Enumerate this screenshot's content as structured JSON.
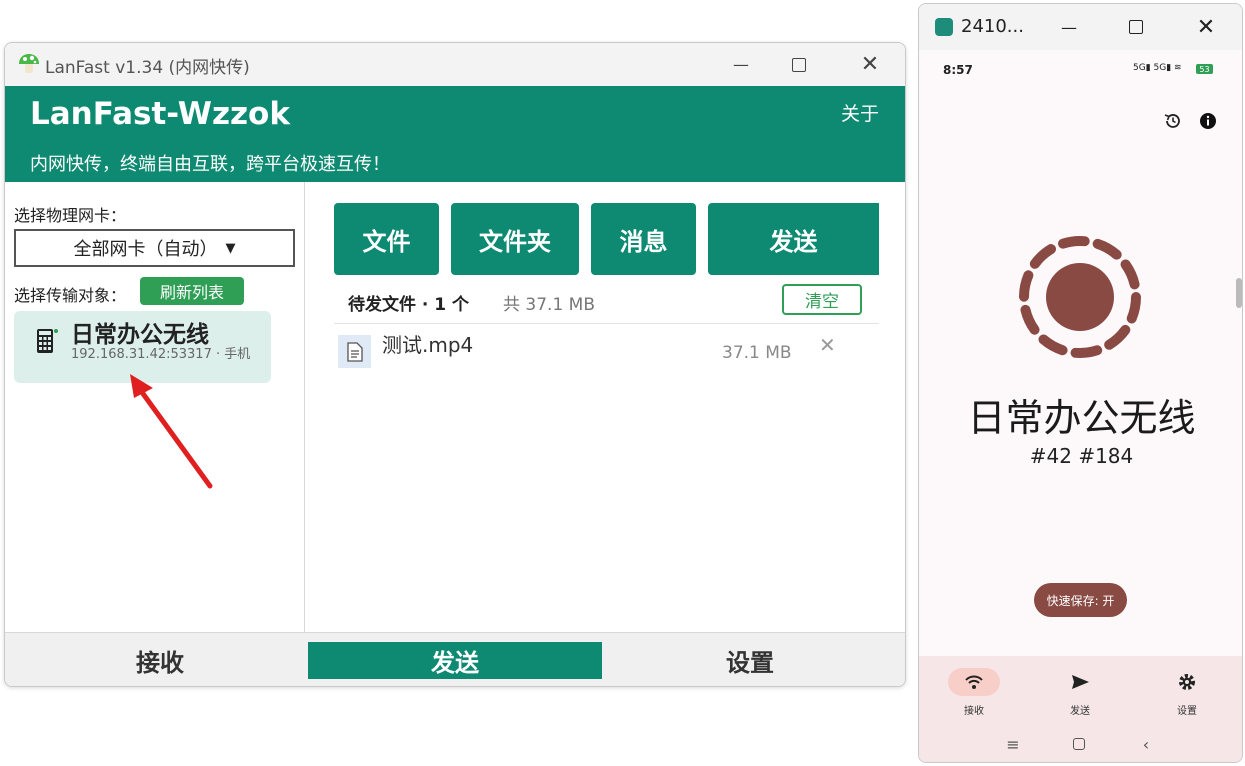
{
  "desktop": {
    "window_title": "LanFast v1.34 (内网快传)",
    "app_name": "LanFast-Wzzok",
    "about_label": "关于",
    "slogan": "内网快传，终端自由互联，跨平台极速互传！",
    "left": {
      "nic_label": "选择物理网卡：",
      "nic_value": "全部网卡（自动）",
      "target_label": "选择传输对象：",
      "refresh_label": "刷新列表",
      "device": {
        "name": "日常办公无线",
        "address": "192.168.31.42:53317 · 手机"
      }
    },
    "right": {
      "buttons": [
        "文件",
        "文件夹",
        "消息",
        "发送"
      ],
      "pending_label": "待发文件 · 1 个",
      "pending_size": "共 37.1 MB",
      "clear_label": "清空",
      "files": [
        {
          "name": "测试.mp4",
          "size": "37.1 MB"
        }
      ]
    },
    "tabs": [
      "接收",
      "发送",
      "设置"
    ],
    "colors": {
      "primary": "#0e8a72",
      "accent_green": "#2e9f55"
    }
  },
  "phone": {
    "window_title": "2410...",
    "time": "8:57",
    "battery": "53",
    "device_name": "日常办公无线",
    "tags": "#42 #184",
    "quick_save": "快速保存: 开",
    "nav": [
      "接收",
      "发送",
      "设置"
    ],
    "colors": {
      "ring": "#8a4a44",
      "nav_active": "#f8cfc8"
    }
  }
}
